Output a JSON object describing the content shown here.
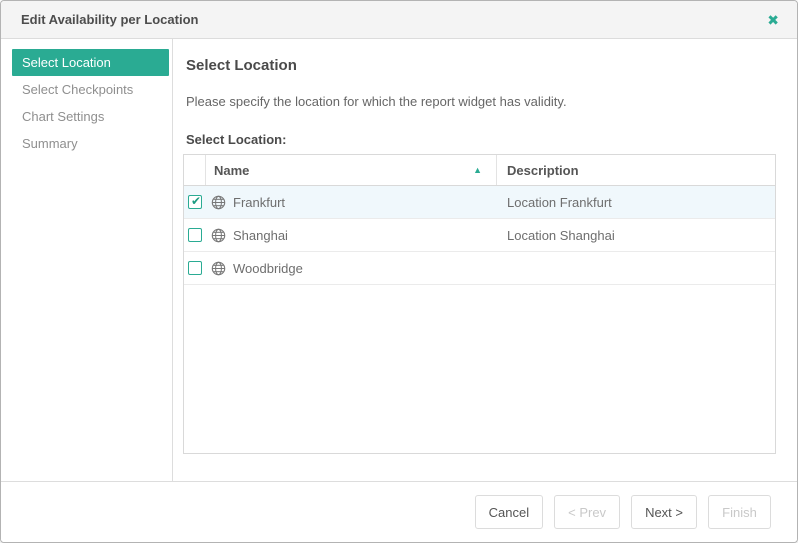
{
  "dialog": {
    "title": "Edit Availability per Location"
  },
  "icons": {
    "close": "✖",
    "sort_asc": "▲",
    "check": "✔"
  },
  "sidebar": {
    "items": [
      {
        "label": "Select Location",
        "active": true
      },
      {
        "label": "Select Checkpoints",
        "active": false
      },
      {
        "label": "Chart Settings",
        "active": false
      },
      {
        "label": "Summary",
        "active": false
      }
    ]
  },
  "content": {
    "heading": "Select Location",
    "description": "Please specify the location for which the report widget has validity.",
    "table_label": "Select Location:",
    "table": {
      "columns": [
        "",
        "Name",
        "Description"
      ],
      "sort": {
        "column": "Name",
        "direction": "ascending"
      },
      "rows": [
        {
          "checked": true,
          "name": "Frankfurt",
          "description": "Location Frankfurt",
          "selected": true
        },
        {
          "checked": false,
          "name": "Shanghai",
          "description": "Location Shanghai",
          "selected": false
        },
        {
          "checked": false,
          "name": "Woodbridge",
          "description": "",
          "selected": false
        }
      ]
    }
  },
  "footer": {
    "buttons": [
      {
        "label": "Cancel",
        "enabled": true
      },
      {
        "label": "< Prev",
        "enabled": false
      },
      {
        "label": "Next >",
        "enabled": true
      },
      {
        "label": "Finish",
        "enabled": false
      }
    ]
  },
  "colors": {
    "accent": "#2aab93",
    "checkmark": "#1d9b82",
    "selected_row": "#f0f8fc",
    "header_bg": "#f4f4f4"
  }
}
